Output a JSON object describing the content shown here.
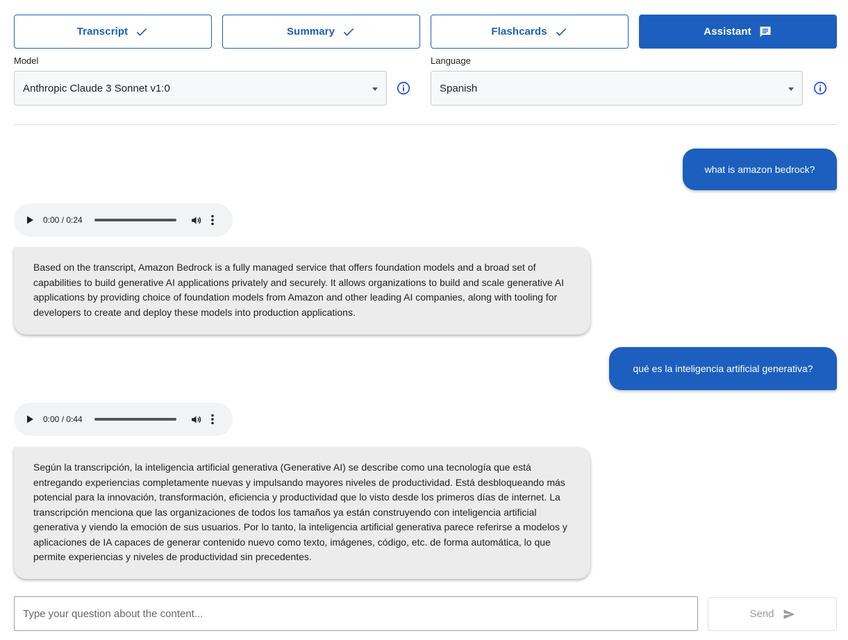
{
  "tabs": [
    {
      "label": "Transcript",
      "icon": "check-icon",
      "active": false
    },
    {
      "label": "Summary",
      "icon": "check-icon",
      "active": false
    },
    {
      "label": "Flashcards",
      "icon": "check-icon",
      "active": false
    },
    {
      "label": "Assistant",
      "icon": "chat-icon",
      "active": true
    }
  ],
  "model": {
    "label": "Model",
    "value": "Anthropic Claude 3 Sonnet v1:0"
  },
  "language": {
    "label": "Language",
    "value": "Spanish"
  },
  "chat": {
    "user_message_1": "what is amazon bedrock?",
    "audio_1": {
      "time": "0:00 / 0:24"
    },
    "bot_message_1": "Based on the transcript, Amazon Bedrock is a fully managed service that offers foundation models and a broad set of capabilities to build generative AI applications privately and securely. It allows organizations to build and scale generative AI applications by providing choice of foundation models from Amazon and other leading AI companies, along with tooling for developers to create and deploy these models into production applications.",
    "user_message_2": "qué es la inteligencia artificial generativa?",
    "audio_2": {
      "time": "0:00 / 0:44"
    },
    "bot_message_2": "Según la transcripción, la inteligencia artificial generativa (Generative AI) se describe como una tecnología que está entregando experiencias completamente nuevas y impulsando mayores niveles de productividad. Está desbloqueando más potencial para la innovación, transformación, eficiencia y productividad que lo visto desde los primeros días de internet. La transcripción menciona que las organizaciones de todos los tamaños ya están construyendo con inteligencia artificial generativa y viendo la emoción de sus usuarios. Por lo tanto, la inteligencia artificial generativa parece referirse a modelos y aplicaciones de IA capaces de generar contenido nuevo como texto, imágenes, código, etc. de forma automática, lo que permite experiencias y niveles de productividad sin precedentes."
  },
  "input": {
    "placeholder": "Type your question about the content...",
    "value": ""
  },
  "send": {
    "label": "Send",
    "icon": "send-icon"
  },
  "colors": {
    "accent": "#1c5fbe",
    "bot_bubble": "#ececec",
    "audio_bg": "#f1f3f4"
  }
}
